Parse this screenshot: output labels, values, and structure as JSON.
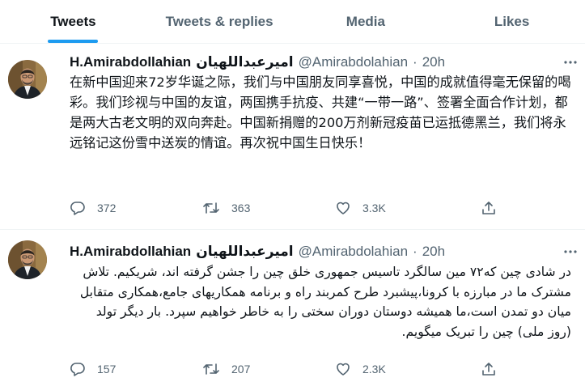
{
  "tabs": [
    {
      "label": "Tweets"
    },
    {
      "label": "Tweets & replies"
    },
    {
      "label": "Media"
    },
    {
      "label": "Likes"
    }
  ],
  "accent_color": "#1d9bf0",
  "tweets": [
    {
      "name": "H.Amirabdollahian",
      "name_fa": "امیرعبداللهیان",
      "handle": "@Amirabdolahian",
      "dot": "·",
      "time": "20h",
      "text": "在新中国迎来72岁华诞之际，我们与中国朋友同享喜悦，中国的成就值得毫无保留的喝彩。我们珍视与中国的友谊，两国携手抗疫、共建“一带一路”、签署全面合作计划，都是两大古老文明的双向奔赴。中国新捐赠的200万剂新冠疫苗已运抵德黑兰，我们将永远铭记这份雪中送炭的情谊。再次祝中国生日快乐！",
      "replies": "372",
      "retweets": "363",
      "likes": "3.3K"
    },
    {
      "name": "H.Amirabdollahian",
      "name_fa": "امیرعبداللهیان",
      "handle": "@Amirabdolahian",
      "dot": "·",
      "time": "20h",
      "text": "در شادی چین که۷۲ مین سالگرد تاسیس جمهوری خلق چین را جشن گرفته اند، شریکیم. تلاش مشترک ما در مبارزه با کرونا،پیشبرد طرح کمربند راه و برنامه همکاریهای جامع،همکاری متقابل میان دو تمدن است،ما همیشه دوستان دوران سختی را به خاطر خواهیم سپرد. بار دیگر تولد (روز ملی) چین را تبریک میگویم.",
      "replies": "157",
      "retweets": "207",
      "likes": "2.3K"
    }
  ]
}
